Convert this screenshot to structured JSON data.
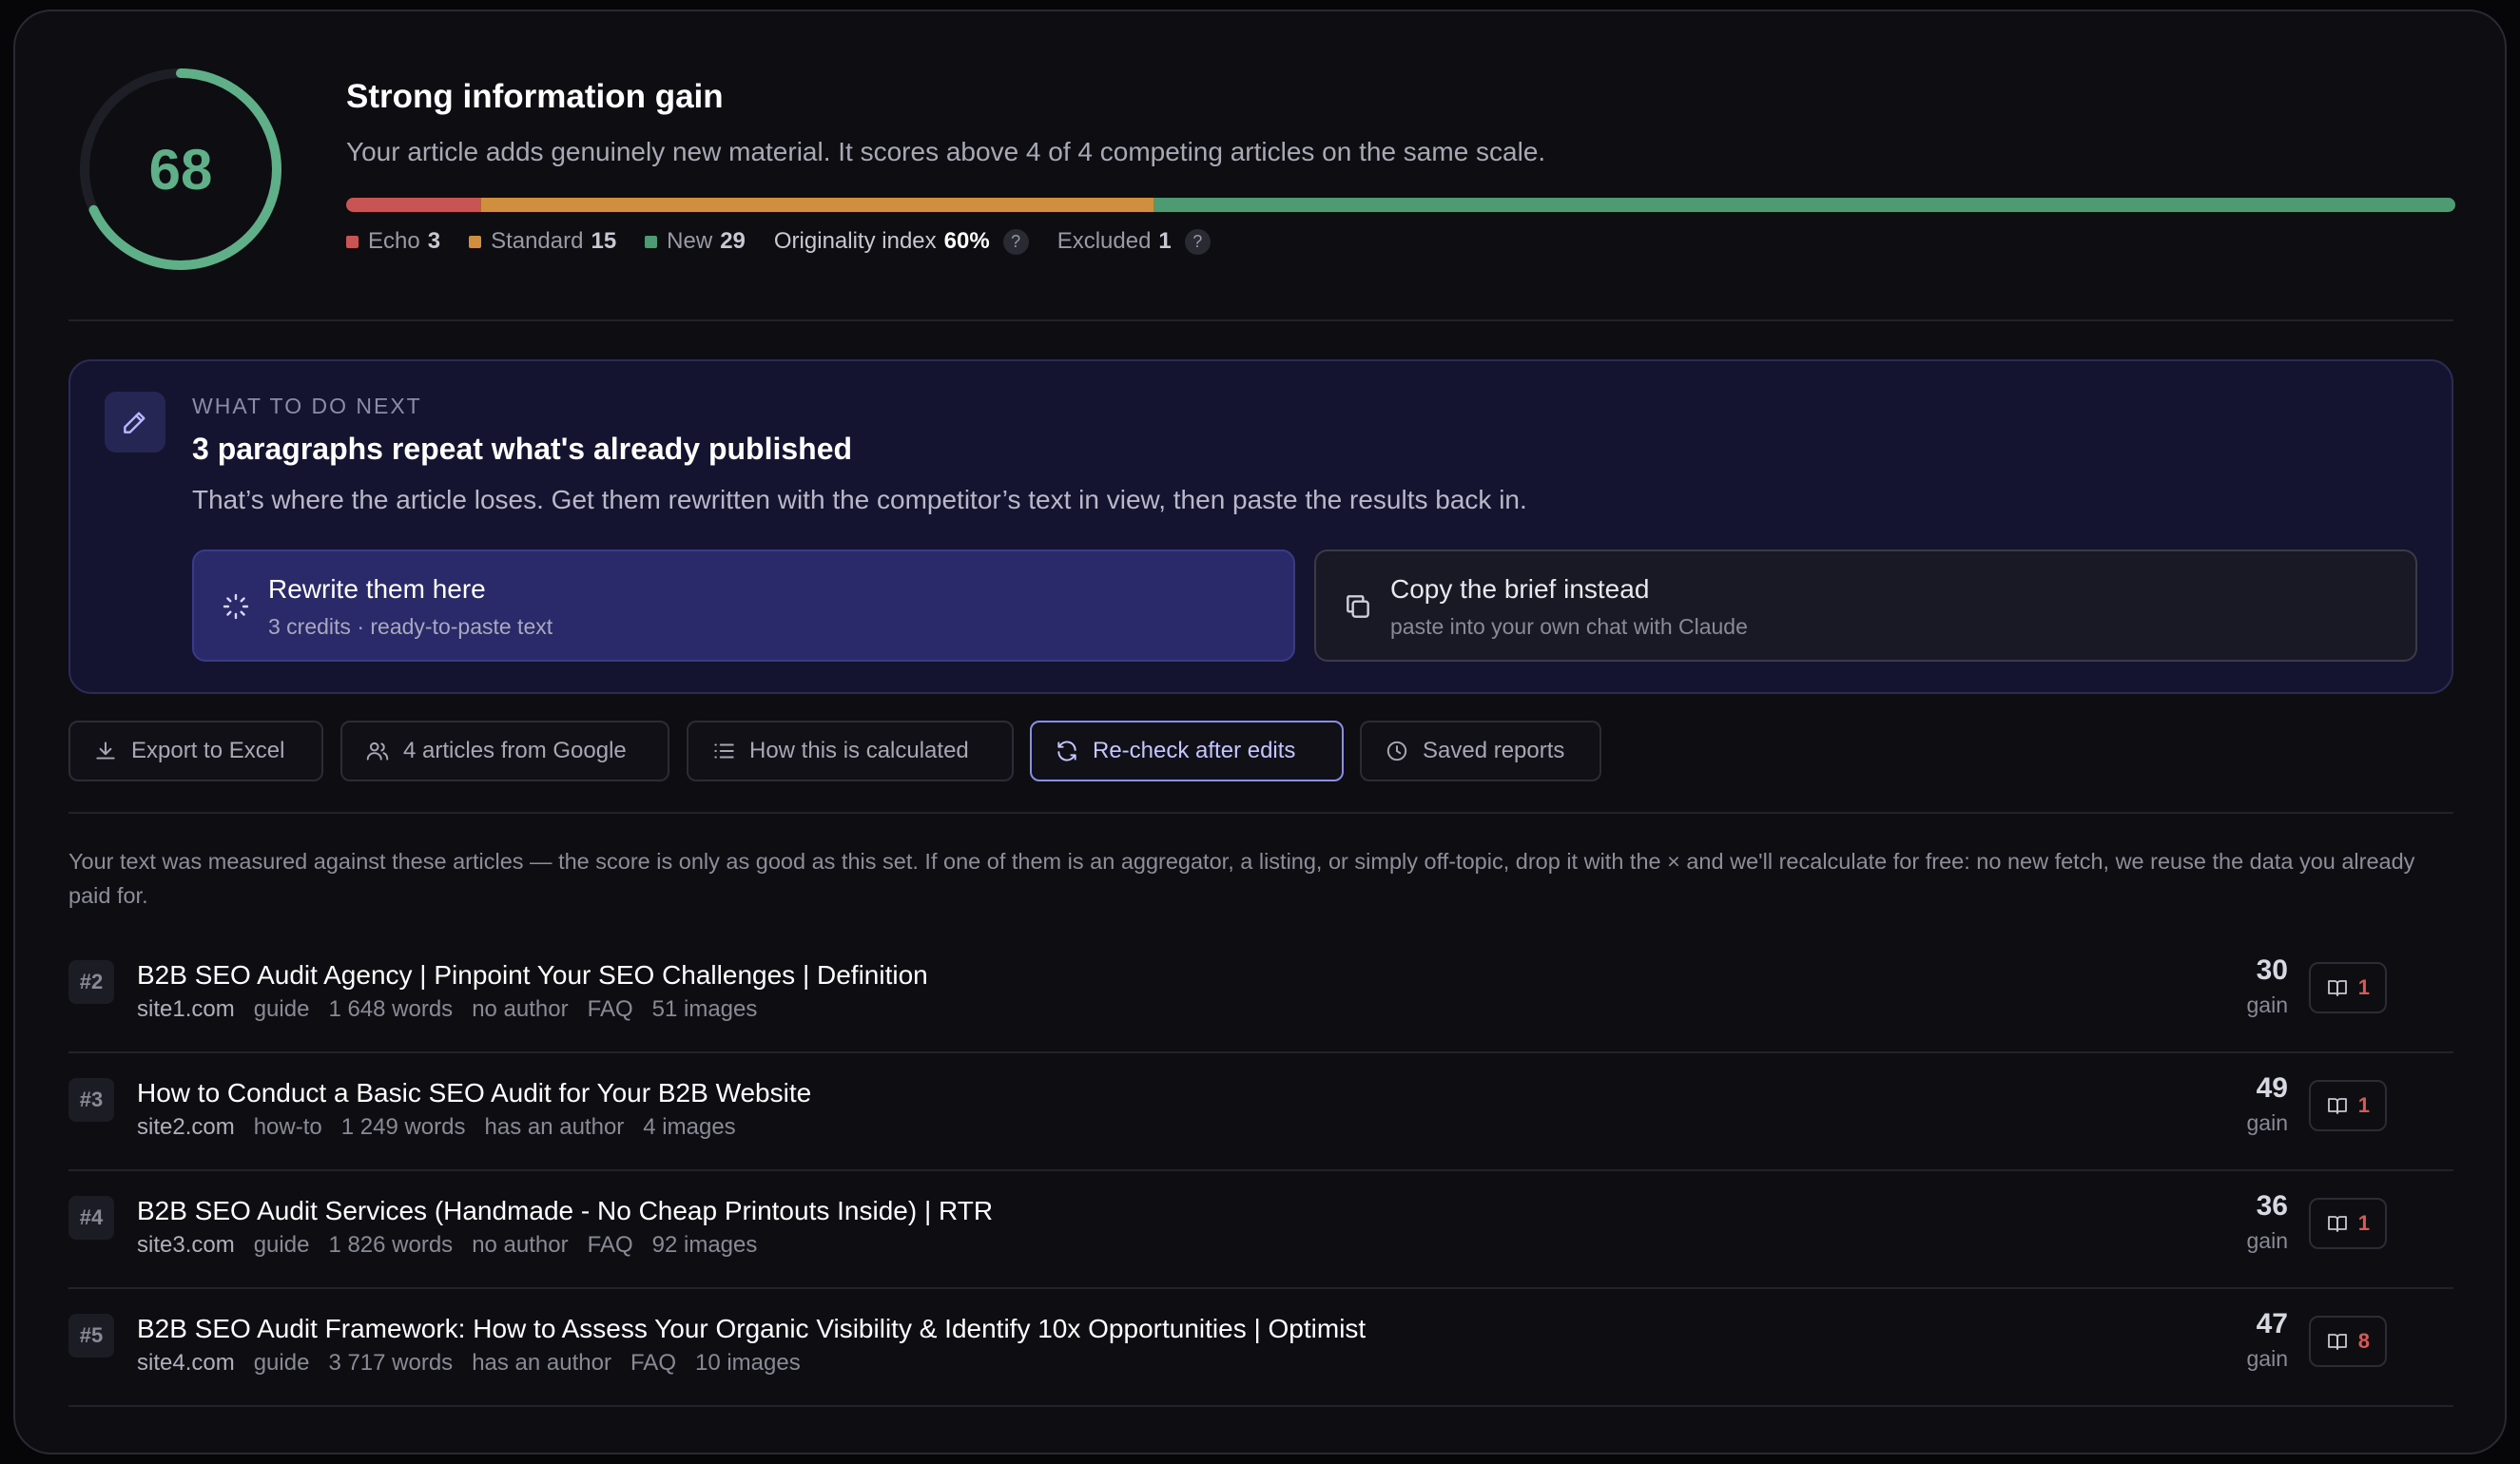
{
  "score": {
    "value": "68",
    "fraction": 0.68,
    "color": "#5fb088",
    "title": "Strong information gain",
    "subtitle": "Your article adds genuinely new material. It scores above 4 of 4 competing articles on the same scale."
  },
  "distribution": {
    "segments": [
      {
        "name": "Echo",
        "value": 3,
        "color": "#c85454"
      },
      {
        "name": "Standard",
        "value": 15,
        "color": "#cf8f3e"
      },
      {
        "name": "New",
        "value": 29,
        "color": "#4e9a72"
      }
    ],
    "legend": [
      {
        "label": "Echo",
        "value": "3",
        "color": "#c85454"
      },
      {
        "label": "Standard",
        "value": "15",
        "color": "#cf8f3e"
      },
      {
        "label": "New",
        "value": "29",
        "color": "#4e9a72"
      }
    ],
    "originality_label": "Originality index",
    "originality_value": "60%",
    "excluded_label": "Excluded",
    "excluded_value": "1",
    "help_glyph": "?"
  },
  "next": {
    "eyebrow": "WHAT TO DO NEXT",
    "title": "3 paragraphs repeat what's already published",
    "description": "That’s where the article loses. Get them rewritten with the competitor’s text in view, then paste the results back in.",
    "primary": {
      "label": "Rewrite them here",
      "sublabel": "3 credits · ready-to-paste text"
    },
    "secondary": {
      "label": "Copy the brief instead",
      "sublabel": "paste into your own chat with Claude"
    }
  },
  "toolbar": {
    "export": "Export to Excel",
    "articles": "4 articles from Google",
    "how": "How this is calculated",
    "recheck": "Re-check after edits",
    "saved": "Saved reports"
  },
  "note": "Your text was measured against these articles — the score is only as good as this set. If one of them is an aggregator, a listing, or simply off-topic, drop it with the × and we'll recalculate for free: no new fetch, we reuse the data you already paid for.",
  "articles": [
    {
      "rank": "#2",
      "title": "B2B SEO Audit Agency | Pinpoint Your SEO Challenges | Definition",
      "site": "site1.com",
      "meta": [
        "guide",
        "1 648 words",
        "no author",
        "FAQ",
        "51 images"
      ],
      "gain": "30",
      "gain_label": "gain",
      "repeats": "1"
    },
    {
      "rank": "#3",
      "title": "How to Conduct a Basic SEO Audit for Your B2B Website",
      "site": "site2.com",
      "meta": [
        "how-to",
        "1 249 words",
        "has an author",
        "4 images"
      ],
      "gain": "49",
      "gain_label": "gain",
      "repeats": "1"
    },
    {
      "rank": "#4",
      "title": "B2B SEO Audit Services (Handmade - No Cheap Printouts Inside) | RTR",
      "site": "site3.com",
      "meta": [
        "guide",
        "1 826 words",
        "no author",
        "FAQ",
        "92 images"
      ],
      "gain": "36",
      "gain_label": "gain",
      "repeats": "1"
    },
    {
      "rank": "#5",
      "title": "B2B SEO Audit Framework: How to Assess Your Organic Visibility & Identify 10x Opportunities | Optimist",
      "site": "site4.com",
      "meta": [
        "guide",
        "3 717 words",
        "has an author",
        "FAQ",
        "10 images"
      ],
      "gain": "47",
      "gain_label": "gain",
      "repeats": "8"
    }
  ]
}
